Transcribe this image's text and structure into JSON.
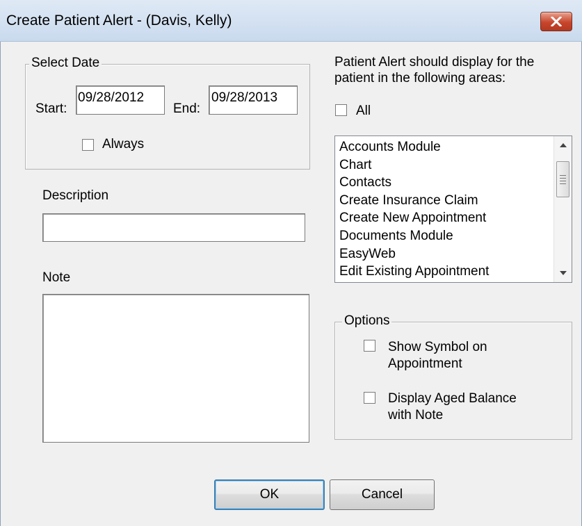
{
  "window": {
    "title": "Create Patient Alert - (Davis, Kelly)"
  },
  "select_date": {
    "legend": "Select Date",
    "start_label": "Start:",
    "start_value": "09/28/2012",
    "end_label": "End:",
    "end_value": "09/28/2013",
    "always_label": "Always",
    "always_checked": false
  },
  "description": {
    "label": "Description",
    "value": ""
  },
  "note": {
    "label": "Note",
    "value": ""
  },
  "areas": {
    "header_line1": "Patient Alert should display for the",
    "header_line2": "patient in the following areas:",
    "all_label": "All",
    "all_checked": false,
    "items": [
      "Accounts Module",
      "Chart",
      "Contacts",
      "Create Insurance Claim",
      "Create New Appointment",
      "Documents Module",
      "EasyWeb",
      "Edit Existing Appointment"
    ]
  },
  "options": {
    "legend": "Options",
    "show_symbol_line1": "Show Symbol on",
    "show_symbol_line2": "Appointment",
    "aged_balance_line1": "Display Aged Balance",
    "aged_balance_line2": "with Note"
  },
  "buttons": {
    "ok": "OK",
    "cancel": "Cancel"
  },
  "colors": {
    "close_button": "#c7452c",
    "titlebar": "#dfe9f5",
    "client_bg": "#f0f0f0"
  },
  "icons": {
    "close": "close-icon",
    "scroll_up": "scroll-up-arrow-icon",
    "scroll_down": "scroll-down-arrow-icon"
  }
}
